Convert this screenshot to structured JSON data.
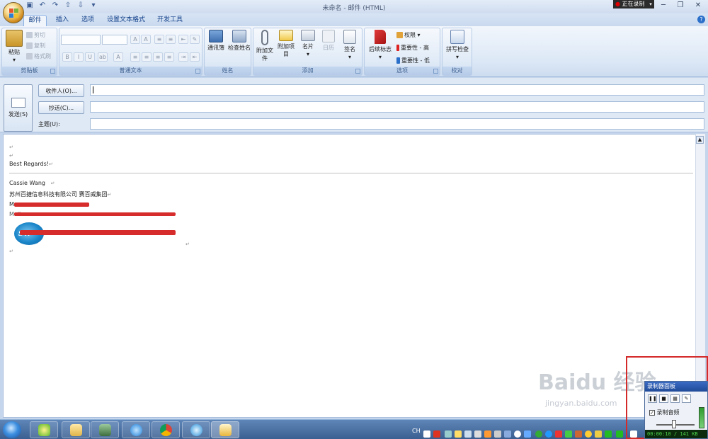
{
  "window": {
    "title": "未命名 - 邮件 (HTML)",
    "recording_status": "正在录制",
    "qat_icons": [
      "save-icon",
      "undo-icon",
      "redo-icon",
      "arrow-up-icon",
      "arrow-down-icon",
      "customize-icon"
    ]
  },
  "ribbon": {
    "tabs": [
      {
        "label": "邮件",
        "active": true
      },
      {
        "label": "插入",
        "active": false
      },
      {
        "label": "选项",
        "active": false
      },
      {
        "label": "设置文本格式",
        "active": false
      },
      {
        "label": "开发工具",
        "active": false
      }
    ],
    "groups": {
      "clipboard": {
        "label": "剪贴板",
        "paste": "粘贴",
        "cut": "剪切",
        "copy": "复制",
        "format_painter": "格式刷"
      },
      "basic_text": {
        "label": "普通文本"
      },
      "names": {
        "label": "姓名",
        "address_book": "通讯簿",
        "check_names": "检查姓名"
      },
      "include": {
        "label": "添加",
        "attach_file": "附加文件",
        "attach_item": "附加项目",
        "business_card": "名片",
        "calendar": "日历",
        "signature": "签名"
      },
      "options": {
        "label": "选项",
        "follow_up": "后续标志",
        "permission": "权限",
        "high_importance": "重要性 - 高",
        "low_importance": "重要性 - 低"
      },
      "proofing": {
        "label": "校对",
        "spelling": "拼写检查"
      }
    }
  },
  "header": {
    "send": "发送(S)",
    "to_button": "收件人(O)...",
    "cc_button": "抄送(C)...",
    "subject_label": "主题(U):",
    "to_value": "",
    "cc_value": "",
    "subject_value": ""
  },
  "body": {
    "return_mark": "↵",
    "greeting": "Best Regards!",
    "sig_name": "Cassie Wang",
    "sig_company": "苏州百捷信息科技有限公司  赛百威集团",
    "sig_phone_prefix": "M",
    "sig_mail_prefix": "Mail:",
    "logo_text": "SW"
  },
  "taskbar": {
    "apps": [
      "explorer",
      "app-green",
      "folder",
      "app-terminal",
      "internet-explorer",
      "chrome",
      "app-blue",
      "outlook"
    ],
    "tray_lang": "CH"
  },
  "recorder": {
    "title": "录制器面板",
    "audio_label": "录制音频",
    "status": "00:00:10 / 141 KB"
  },
  "watermark": {
    "main": "Baidu 经验",
    "sub": "jingyan.baidu.com"
  },
  "colors": {
    "ribbon_blue": "#15428b",
    "redaction": "#d62c2c",
    "recorder_frame": "#d42a2a"
  }
}
